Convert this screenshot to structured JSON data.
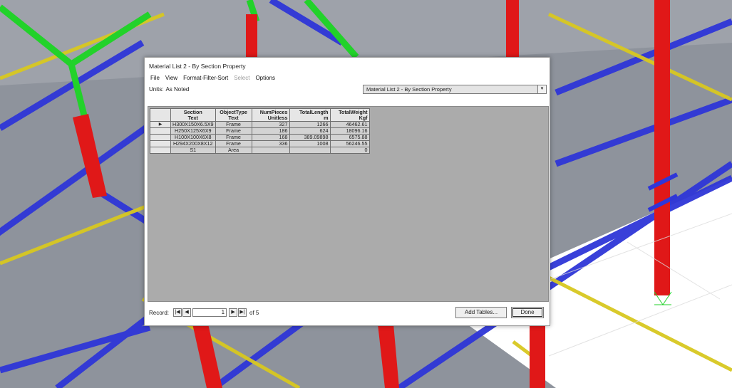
{
  "dialog": {
    "title": "Material List 2 - By Section Property",
    "menu": [
      {
        "label": "File",
        "enabled": true
      },
      {
        "label": "View",
        "enabled": true
      },
      {
        "label": "Format-Filter-Sort",
        "enabled": true
      },
      {
        "label": "Select",
        "enabled": false
      },
      {
        "label": "Options",
        "enabled": true
      }
    ],
    "units_label": "Units:",
    "units_value": "As Noted",
    "table_select": "Material List 2 - By Section Property",
    "table": {
      "headers": [
        {
          "name": "Section",
          "unit": "Text"
        },
        {
          "name": "ObjectType",
          "unit": "Text"
        },
        {
          "name": "NumPieces",
          "unit": "Unitless"
        },
        {
          "name": "TotalLength",
          "unit": "m"
        },
        {
          "name": "TotalWeight",
          "unit": "Kgf"
        }
      ],
      "rows": [
        [
          "H300X150X6.5X9",
          "Frame",
          "327",
          "1266",
          "46462.61"
        ],
        [
          "H250X125X6X9",
          "Frame",
          "186",
          "624",
          "18096.16"
        ],
        [
          "H100X100X6X8",
          "Frame",
          "168",
          "389.09898",
          "6575.88"
        ],
        [
          "H294X200X8X12",
          "Frame",
          "336",
          "1008",
          "56246.55"
        ],
        [
          "S1",
          "Area",
          "",
          "",
          "0"
        ]
      ],
      "current_row_marker": "▶"
    },
    "footer": {
      "record_label": "Record:",
      "record_value": "1",
      "of_text": "of 5",
      "first": "|◀",
      "prev": "◀",
      "next": "▶",
      "last": "▶|"
    },
    "buttons": {
      "add_tables": "Add Tables...",
      "done": "Done"
    }
  }
}
